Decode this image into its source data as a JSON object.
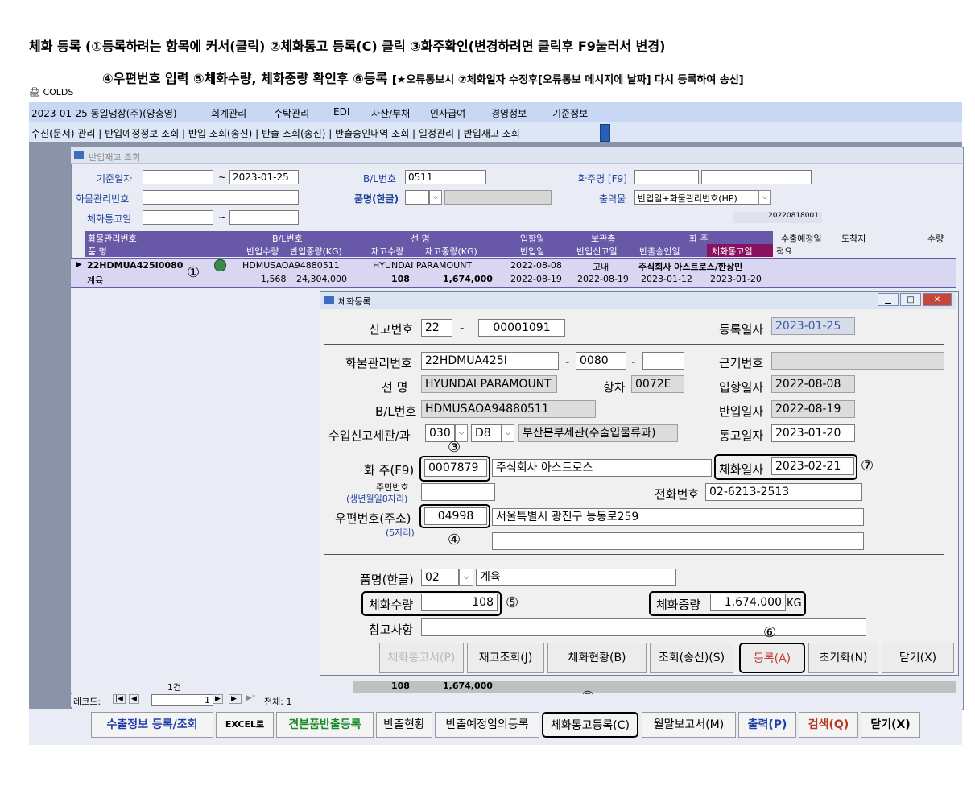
{
  "instructions": {
    "line1": "체화 등록 (①등록하려는 항목에 커서(클릭) ②체화통고 등록(C) 클릭 ③화주확인(변경하려면 클릭후 F9눌러서 변경)",
    "line2_main": "④우편번호 입력 ⑤체화수량, 체화중량 확인후 ⑥등록",
    "line2_note": "[★오류통보시 ⑦체화일자 수정후[오류통보 메시지에 날짜] 다시 등록하여 송신]"
  },
  "app_title": "COLDS",
  "menubar": {
    "items": [
      "2023-01-25 동일냉장(주)(양충영)",
      "회계관리",
      "수탁관리",
      "EDI",
      "자산/부채",
      "인사급여",
      "경영정보",
      "기준정보"
    ]
  },
  "toolbar2": {
    "items": [
      "수신(문서) 관리",
      "반입예정정보 조회",
      "반입 조회(송신)",
      "반출 조회(송신)",
      "반출승인내역 조회",
      "일정관리",
      "반입재고 조회"
    ]
  },
  "panel": {
    "title": "반입재고 조회",
    "filters": {
      "base_date_label": "기준일자",
      "base_date_from": "",
      "base_date_to": "2023-01-25",
      "bl_label": "B/L번호",
      "bl_value": "0511",
      "owner_label": "화주명 [F9]",
      "owner_value": "",
      "owner_value2": "",
      "cargo_label": "화물관리번호",
      "cargo_value": "",
      "item_label": "품명(한글)",
      "item_value": "",
      "item_desc": "",
      "output_label": "출력물",
      "output_value": "반입일+화물관리번호(HP)",
      "notice_label": "체화통고일",
      "notice_from": "",
      "notice_to": "",
      "code_display": "20220818001"
    },
    "grid_headers_row1": [
      "화물관리번호",
      "B/L번호",
      "선     명",
      "입항일",
      "보관층",
      "화          주",
      "수출예정일",
      "도착지",
      "수량"
    ],
    "grid_headers_row2": [
      "품      명",
      "반입수량",
      "반입중량(KG)",
      "재고수량",
      "재고중량(KG)",
      "반입일",
      "반입신고일",
      "반출승인일",
      "체화통고일",
      "적요"
    ],
    "row": {
      "cargo_no": "22HDMUA425I0080",
      "bl_no": "HDMUSAOA94880511",
      "vessel": "HYUNDAI PARAMOUNT",
      "arrival_date": "2022-08-08",
      "floor": "고내",
      "owner": "주식회사 아스트로스/한상민",
      "item": "계육",
      "in_qty": "1,568",
      "in_weight": "24,304,000",
      "stock_qty": "108",
      "stock_weight": "1,674,000",
      "in_date": "2022-08-19",
      "in_report_date": "2022-08-19",
      "out_approval_date": "2023-01-12",
      "notice_date": "2023-01-20"
    },
    "summary": {
      "count": "1건",
      "qty": "108",
      "weight": "1,674,000"
    },
    "record_nav": {
      "label": "레코드:",
      "current": "1",
      "total": "전체: 1"
    }
  },
  "dialog": {
    "title": "체화등록",
    "report_no_label": "신고번호",
    "report_no_a": "22",
    "dash": "-",
    "report_no_b": "00001091",
    "reg_date_label": "등록일자",
    "reg_date": "2023-01-25",
    "cargo_label": "화물관리번호",
    "cargo_main": "22HDMUA425I",
    "cargo_sub": "0080",
    "cargo_sub2": "",
    "basis_label": "근거번호",
    "basis_value": "",
    "vessel_label": "선    명",
    "vessel_value": "HYUNDAI PARAMOUNT",
    "voyage_label": "항차",
    "voyage_value": "0072E",
    "arrival_label": "입항일자",
    "arrival_value": "2022-08-08",
    "bl_label": "B/L번호",
    "bl_value": "HDMUSAOA94880511",
    "in_date_label": "반입일자",
    "in_date_value": "2022-08-19",
    "customs_label": "수입신고세관/과",
    "customs_code": "030",
    "customs_div": "D8",
    "customs_name": "부산본부세관(수출입물류과)",
    "notice_label": "통고일자",
    "notice_value": "2023-01-20",
    "owner_label": "화  주(F9)",
    "owner_code": "0007879",
    "owner_name": "주식회사 아스트로스",
    "overdue_label": "체화일자",
    "overdue_value": "2023-02-21",
    "resident_label": "주민번호",
    "resident_hint": "(생년월일8자리)",
    "resident_value": "",
    "phone_label": "전화번호",
    "phone_value": "02-6213-2513",
    "zip_label": "우편번호(주소)",
    "zip_hint": "(5자리)",
    "zip_value": "04998",
    "address1": "서울특별시 광진구 능동로259",
    "address2": "",
    "item_label": "품명(한글)",
    "item_code": "02",
    "item_name": "계육",
    "qty_label": "체화수량",
    "qty_value": "108",
    "weight_label": "체화중량",
    "weight_value": "1,674,000",
    "weight_unit": "KG",
    "remark_label": "참고사항",
    "remark_value": "",
    "buttons": [
      "체화통고서(P)",
      "재고조회(J)",
      "체화현황(B)",
      "조회(송신)(S)",
      "등록(A)",
      "초기화(N)",
      "닫기(X)"
    ]
  },
  "bottom_buttons": [
    "수출정보 등록/조회",
    "EXCEL로",
    "견본품반출등록",
    "반출현황",
    "반출예정임의등록",
    "체화통고등록(C)",
    "월말보고서(M)",
    "출력(P)",
    "검색(Q)",
    "닫기(X)"
  ],
  "markers": {
    "m1": "①",
    "m2": "②",
    "m3": "③",
    "m4": "④",
    "m5": "⑤",
    "m6": "⑥",
    "m7": "⑦"
  },
  "colors": {
    "grid_header": "#6858a8",
    "grid_header_highlight": "#8a1060",
    "row_bg": "#d9d6f2",
    "accent_blue": "#1f3f9f"
  }
}
